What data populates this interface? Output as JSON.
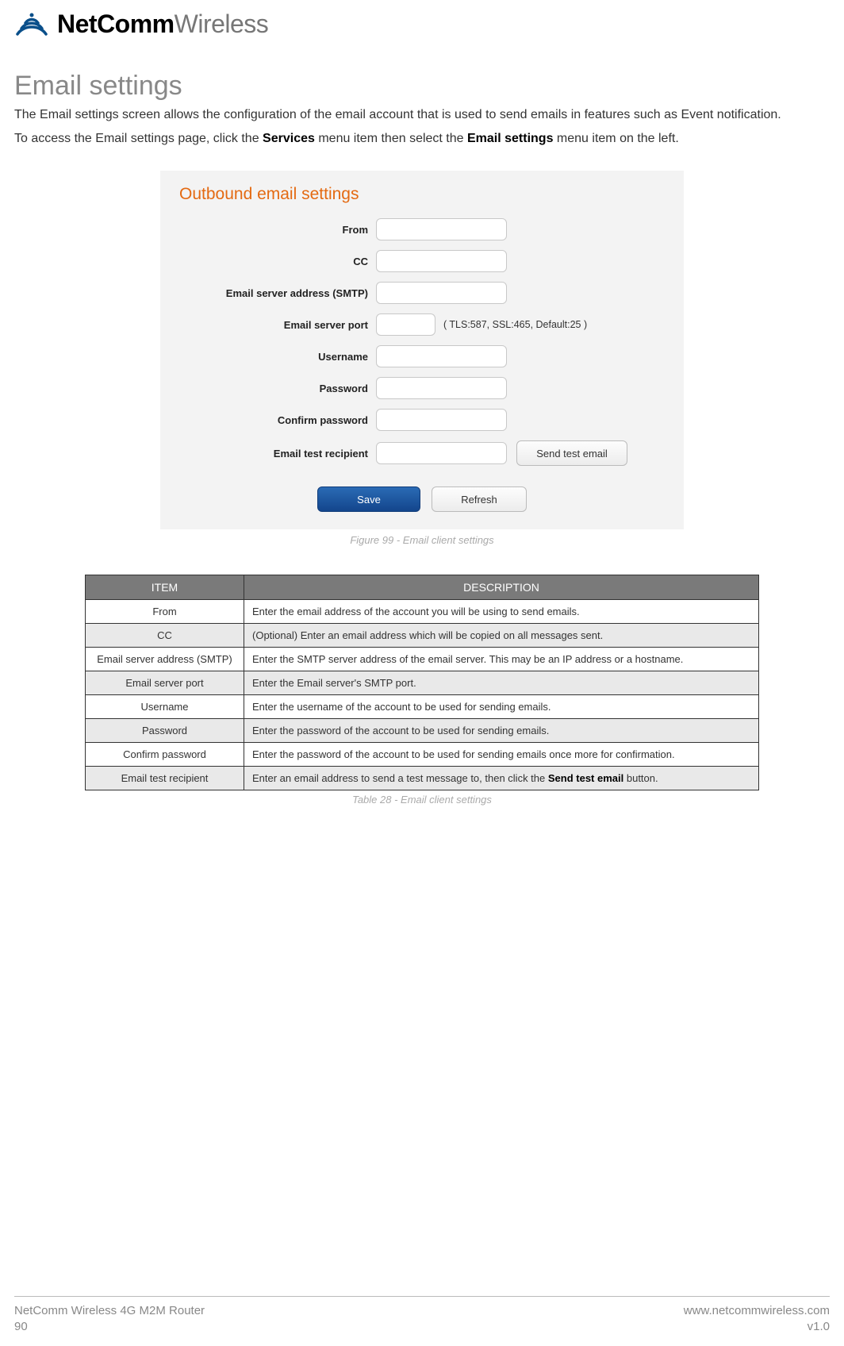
{
  "brand": {
    "bold": "NetComm",
    "light": "Wireless"
  },
  "section_title": "Email settings",
  "intro_p1": "The Email settings screen allows the configuration of the email account that is used to send emails in features such as Event notification.",
  "intro_p2_a": "To access the Email settings page, click the ",
  "intro_p2_b": "Services",
  "intro_p2_c": " menu item then select the ",
  "intro_p2_d": "Email settings",
  "intro_p2_e": " menu item on the left.",
  "panel": {
    "title": "Outbound email settings",
    "labels": {
      "from": "From",
      "cc": "CC",
      "smtp": "Email server address (SMTP)",
      "port": "Email server port",
      "port_hint": "( TLS:587, SSL:465, Default:25 )",
      "username": "Username",
      "password": "Password",
      "confirm": "Confirm password",
      "recipient": "Email test recipient"
    },
    "buttons": {
      "send_test": "Send test email",
      "save": "Save",
      "refresh": "Refresh"
    }
  },
  "figure_caption": "Figure 99 - Email client settings",
  "table": {
    "headers": {
      "item": "ITEM",
      "description": "DESCRIPTION"
    },
    "rows": [
      {
        "item": "From",
        "desc": "Enter the email address of the account you will be using to send emails."
      },
      {
        "item": "CC",
        "desc": "(Optional) Enter an email address which will be copied on all messages sent."
      },
      {
        "item": "Email server address (SMTP)",
        "desc": "Enter the SMTP server address of the email server. This may be an IP address or a hostname."
      },
      {
        "item": "Email server port",
        "desc": "Enter the Email server's SMTP port."
      },
      {
        "item": "Username",
        "desc": "Enter the username of the account to be used for sending emails."
      },
      {
        "item": "Password",
        "desc": "Enter the password of the account to be used for sending emails."
      },
      {
        "item": "Confirm password",
        "desc": "Enter the password of the account to be used for sending emails once more for confirmation."
      },
      {
        "item": "Email test recipient",
        "desc_a": "Enter an email address to send a test message to, then click the ",
        "desc_bold": "Send test email",
        "desc_b": " button."
      }
    ]
  },
  "table_caption": "Table 28 - Email client settings",
  "footer": {
    "product": "NetComm Wireless 4G M2M Router",
    "page": "90",
    "url": "www.netcommwireless.com",
    "version": "v1.0"
  }
}
